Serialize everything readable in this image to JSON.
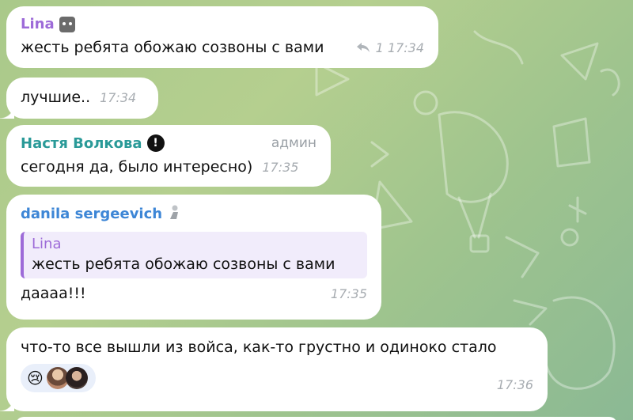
{
  "messages": [
    {
      "sender": "Lina",
      "sender_color": "#9d6bd8",
      "text": "жесть ребята обожаю созвоны с вами",
      "reply_count": "1",
      "time": "17:34",
      "sender_icon": "cat-emoji-icon"
    },
    {
      "text": "лучшие..",
      "time": "17:34"
    },
    {
      "sender": "Настя Волкова",
      "sender_color": "#2a9a98",
      "sender_badge": "exclamation-icon",
      "role": "админ",
      "text": "сегодня да, было интересно)",
      "time": "17:35"
    },
    {
      "sender": "danila sergeevich",
      "sender_color": "#3d86d6",
      "sender_icon": "figure-emoji-icon",
      "quote": {
        "name": "Lina",
        "text": "жесть ребята обожаю созвоны с вами"
      },
      "text": "даааа!!!",
      "time": "17:35"
    },
    {
      "text": "что-то все вышли из войса, как-то грустно и одиноко стало",
      "reaction_icon": "crying-face-icon",
      "reaction_emoji": "😢",
      "time": "17:36"
    }
  ]
}
